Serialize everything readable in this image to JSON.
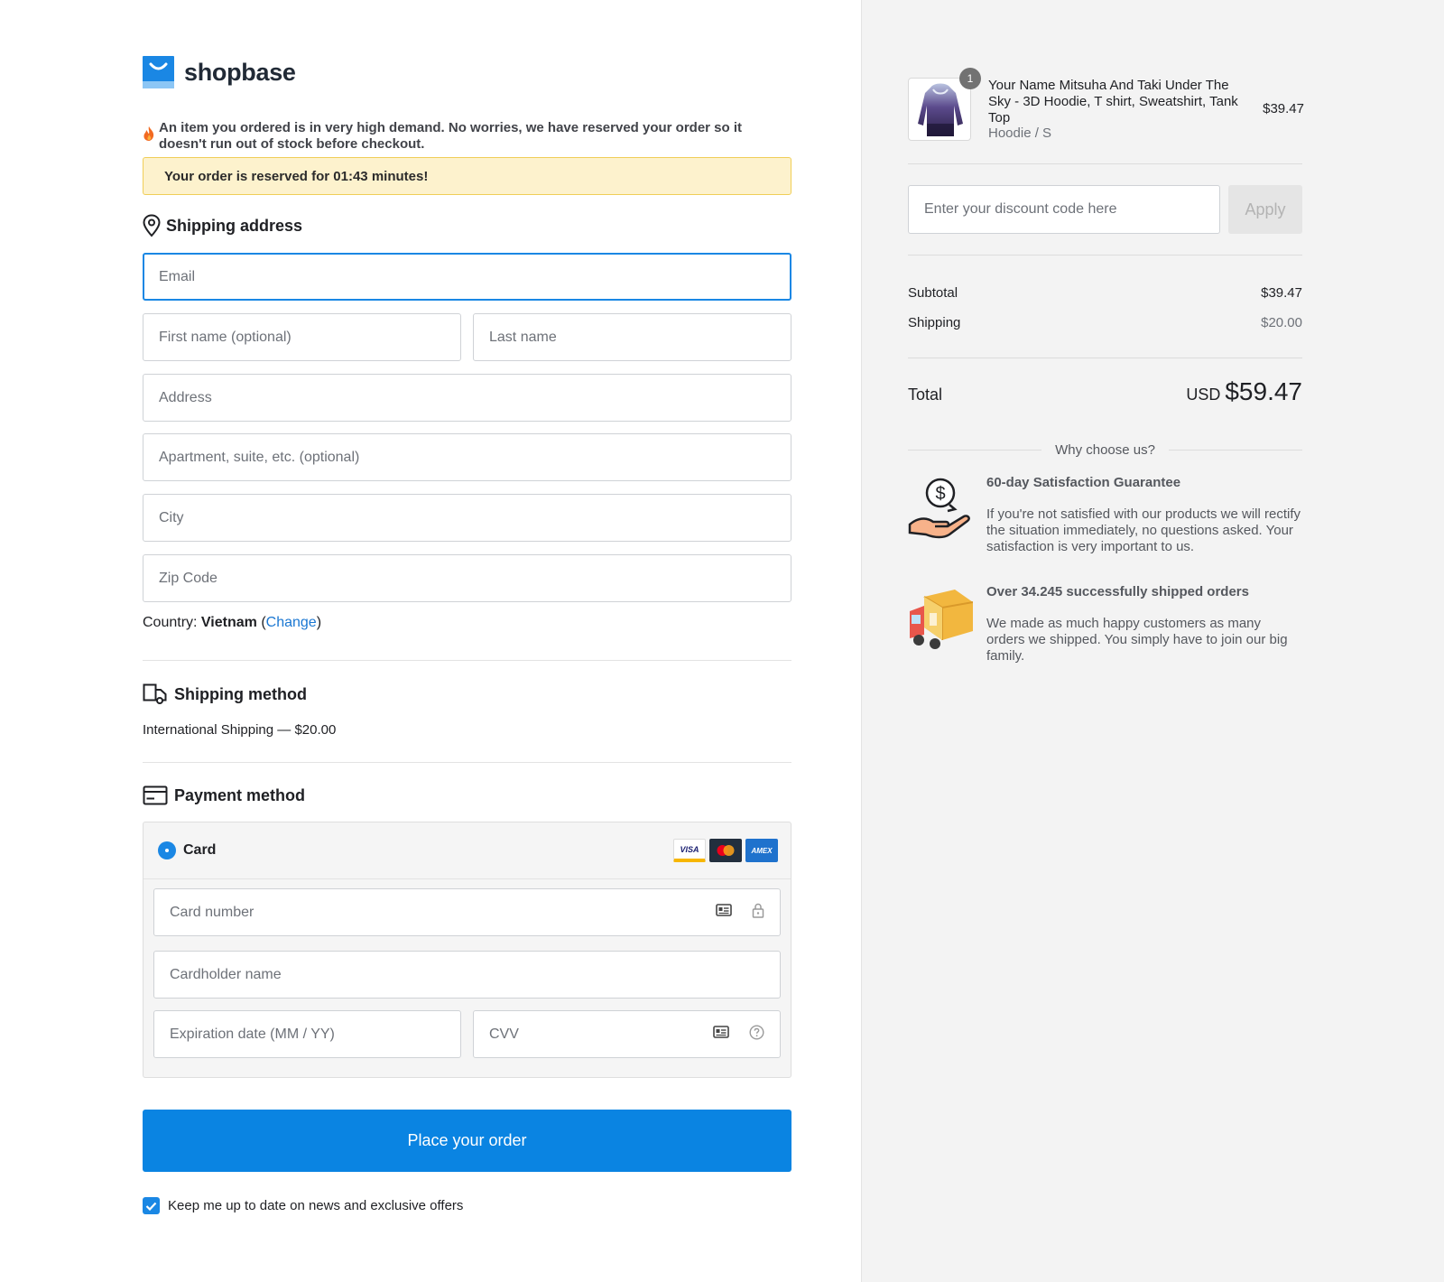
{
  "brand": {
    "name": "shopbase"
  },
  "alert": {
    "demand_text": "An item you ordered is in very high demand. No worries, we have reserved your order so it doesn't run out of stock before checkout.",
    "reserved_text": "Your order is reserved for 01:43 minutes!"
  },
  "shipping_address": {
    "title": "Shipping address",
    "email_placeholder": "Email",
    "first_name_placeholder": "First name (optional)",
    "last_name_placeholder": "Last name",
    "address_placeholder": "Address",
    "apartment_placeholder": "Apartment, suite, etc. (optional)",
    "city_placeholder": "City",
    "zip_placeholder": "Zip Code",
    "country_label": "Country:",
    "country_value": "Vietnam",
    "change_link": "Change"
  },
  "shipping_method": {
    "title": "Shipping method",
    "option": "International Shipping — $20.00"
  },
  "payment": {
    "title": "Payment method",
    "card_label": "Card",
    "card_brands": [
      "VISA",
      "mastercard",
      "AMEX"
    ],
    "card_number_placeholder": "Card number",
    "cardholder_placeholder": "Cardholder name",
    "expiry_placeholder": "Expiration date (MM / YY)",
    "cvv_placeholder": "CVV"
  },
  "place_order_label": "Place your order",
  "newsletter_label": "Keep me up to date on news and exclusive offers",
  "order": {
    "item": {
      "quantity": "1",
      "name": "Your Name Mitsuha And Taki Under The Sky - 3D Hoodie, T shirt, Sweatshirt, Tank Top",
      "variant": "Hoodie / S",
      "price": "$39.47"
    },
    "discount_placeholder": "Enter your discount code here",
    "apply_label": "Apply",
    "subtotal_label": "Subtotal",
    "subtotal_value": "$39.47",
    "shipping_label": "Shipping",
    "shipping_value": "$20.00",
    "total_label": "Total",
    "total_currency": "USD",
    "total_value": "$59.47"
  },
  "why": {
    "heading": "Why choose us?",
    "features": [
      {
        "title": "60-day Satisfaction Guarantee",
        "text": "If you're not satisfied with our products we will rectify the situation immediately, no questions asked. Your satisfaction is very important to us."
      },
      {
        "title": "Over 34.245 successfully shipped orders",
        "text": "We made as much happy customers as many orders we shipped. You simply have to join our big family."
      }
    ]
  },
  "colors": {
    "primary": "#0a84e2",
    "reserve_bg": "#fdf2cd",
    "reserve_border": "#f0ce58",
    "sidebar_bg": "#f3f3f3"
  }
}
